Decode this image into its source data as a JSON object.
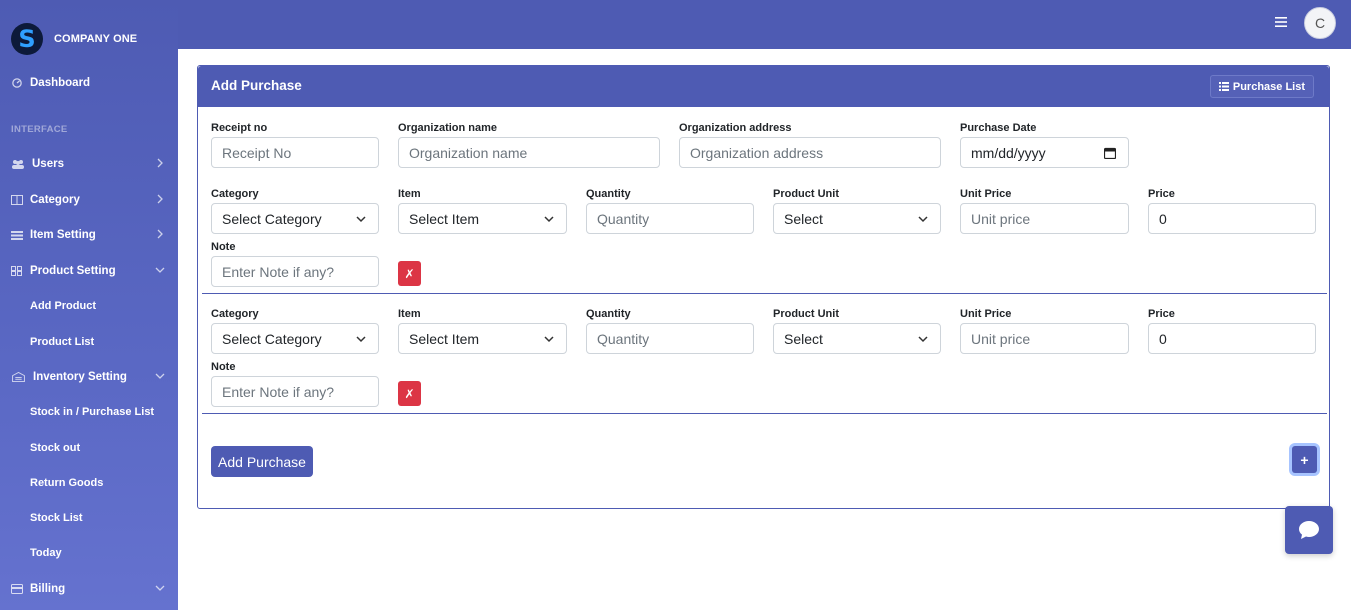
{
  "brand": {
    "name": "COMPANY ONE",
    "logo_letter": "S"
  },
  "sidebar": {
    "heading": "INTERFACE",
    "items": [
      {
        "label": "Dashboard",
        "icon": "dashboard-icon"
      },
      {
        "label": "Users",
        "icon": "users-icon",
        "has_chevron": "right"
      },
      {
        "label": "Category",
        "icon": "category-icon",
        "has_chevron": "right"
      },
      {
        "label": "Item Setting",
        "icon": "list-icon",
        "has_chevron": "right"
      },
      {
        "label": "Product Setting",
        "icon": "product-icon",
        "has_chevron": "down"
      },
      {
        "label": "Inventory Setting",
        "icon": "warehouse-icon",
        "has_chevron": "down"
      },
      {
        "label": "Billing",
        "icon": "billing-icon",
        "has_chevron": "down"
      }
    ],
    "product_sub": [
      "Add Product",
      "Product List"
    ],
    "inventory_sub": [
      "Stock in / Purchase List",
      "Stock out",
      "Return Goods",
      "Stock List",
      "Today"
    ]
  },
  "topbar": {
    "avatar_letter": "C"
  },
  "card": {
    "title": "Add Purchase",
    "list_button": "Purchase List",
    "header_fields": {
      "receipt_label": "Receipt no",
      "receipt_placeholder": "Receipt No",
      "org_name_label": "Organization name",
      "org_name_placeholder": "Organization name",
      "org_address_label": "Organization address",
      "org_address_placeholder": "Organization address",
      "date_label": "Purchase Date",
      "date_placeholder": "mm/dd/yyyy"
    },
    "rows": [
      {
        "category_label": "Category",
        "category_value": "Select Category",
        "item_label": "Item",
        "item_value": "Select Item",
        "quantity_label": "Quantity",
        "quantity_placeholder": "Quantity",
        "unit_label": "Product Unit",
        "unit_value": "Select",
        "unit_price_label": "Unit Price",
        "unit_price_placeholder": "Unit price",
        "price_label": "Price",
        "price_value": "0",
        "note_label": "Note",
        "note_placeholder": "Enter Note if any?",
        "remove_label": "✗"
      },
      {
        "category_label": "Category",
        "category_value": "Select Category",
        "item_label": "Item",
        "item_value": "Select Item",
        "quantity_label": "Quantity",
        "quantity_placeholder": "Quantity",
        "unit_label": "Product Unit",
        "unit_value": "Select",
        "unit_price_label": "Unit Price",
        "unit_price_placeholder": "Unit price",
        "price_label": "Price",
        "price_value": "0",
        "note_label": "Note",
        "note_placeholder": "Enter Note if any?",
        "remove_label": "✗"
      }
    ],
    "submit_label": "Add Purchase",
    "add_row_label": "+"
  },
  "colors": {
    "primary": "#4e5bb3",
    "danger": "#dc3545",
    "focus_ring": "#a7c4ff"
  }
}
